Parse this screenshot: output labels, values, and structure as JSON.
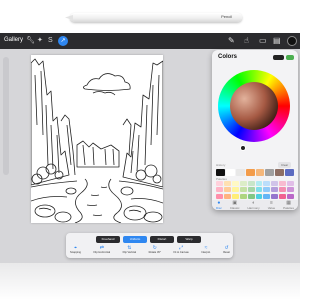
{
  "pencil": {
    "brand": "Pencil"
  },
  "toolbar": {
    "gallery_label": "Gallery",
    "left_icons": [
      "wrench-icon",
      "magic-wand-icon",
      "selection-icon",
      "transform-arrow-icon"
    ],
    "right_icons": [
      "brush-icon",
      "smudge-icon",
      "eraser-icon",
      "layers-icon"
    ],
    "current_color": "#111111"
  },
  "colors_panel": {
    "title": "Colors",
    "current_swatch": "#222222",
    "previous_swatch": "#4caf50",
    "history_label": "History",
    "clear_label": "Clear",
    "palettes_label": "Palettes",
    "history_colors": [
      "#111111",
      "#ffffff",
      "#e8e8e8",
      "#f39c4a",
      "#f5b77a",
      "#a0a0a0",
      "#8d6e63",
      "#5c6bc0"
    ],
    "palette_colors": [
      "#ffd1dc",
      "#ffe0b2",
      "#fff9c4",
      "#dcedc8",
      "#c8e6c9",
      "#b2ebf2",
      "#bbdefb",
      "#d1c4e9",
      "#f8bbd0",
      "#e1bee7",
      "#ffb3c6",
      "#ffcc99",
      "#fff59d",
      "#c5e1a5",
      "#a5d6a7",
      "#80deea",
      "#90caf9",
      "#b39ddb",
      "#f48fb1",
      "#ce93d8",
      "#ff8fab",
      "#ffb380",
      "#ffee77",
      "#aed581",
      "#81c784",
      "#4dd0e1",
      "#64b5f6",
      "#9575cd",
      "#f06292",
      "#ba68c8"
    ],
    "tabs": [
      {
        "label": "Disc",
        "icon": "disc-icon"
      },
      {
        "label": "Classic",
        "icon": "classic-icon"
      },
      {
        "label": "Harmony",
        "icon": "harmony-icon"
      },
      {
        "label": "Value",
        "icon": "value-icon"
      },
      {
        "label": "Palettes",
        "icon": "palettes-icon"
      }
    ],
    "active_tab": "Disc"
  },
  "selection_toolbar": {
    "modes": [
      "Freehand",
      "Uniform",
      "Distort",
      "Warp"
    ],
    "active_mode": "Uniform",
    "ops": [
      {
        "label": "Snapping",
        "icon": "snapping-icon"
      },
      {
        "label": "Flip Horizontal",
        "icon": "flip-horizontal-icon"
      },
      {
        "label": "Flip Vertical",
        "icon": "flip-vertical-icon"
      },
      {
        "label": "Rotate 45°",
        "icon": "rotate-icon"
      },
      {
        "label": "Fit to Canvas",
        "icon": "fit-canvas-icon"
      },
      {
        "label": "Interpol.",
        "icon": "interpolation-icon"
      },
      {
        "label": "Reset",
        "icon": "reset-icon"
      }
    ]
  },
  "artwork": {
    "subject": "canyon-river-coloring-page"
  }
}
